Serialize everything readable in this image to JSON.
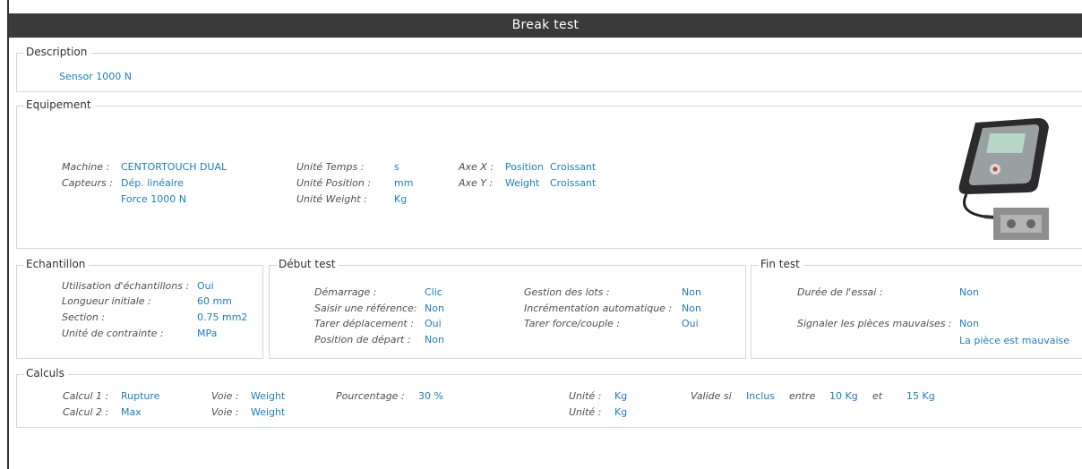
{
  "window": {
    "title": "Break test"
  },
  "description": {
    "legend": "Description",
    "value": "Sensor 1000 N"
  },
  "equipement": {
    "legend": "Equipement",
    "machine_label": "Machine :",
    "machine_value": "CENTORTOUCH DUAL",
    "capteurs_label": "Capteurs :",
    "capteur1": "Dép. linéaire",
    "capteur2": "Force 1000 N",
    "temps_label": "Unité Temps :",
    "temps_value": "s",
    "position_label": "Unité Position :",
    "position_value": "mm",
    "weight_label": "Unité Weight :",
    "weight_value": "Kg",
    "axex_label": "Axe X :",
    "axex_value": "Position",
    "axex_dir": "Croissant",
    "axey_label": "Axe Y :",
    "axey_value": "Weight",
    "axey_dir": "Croissant",
    "image_icon": "force-gauge-device-icon"
  },
  "echantillon": {
    "legend": "Echantillon",
    "utilisation_label": "Utilisation d'échantillons :",
    "utilisation_value": "Oui",
    "longueur_label": "Longueur initiale :",
    "longueur_value": "60 mm",
    "section_label": "Section :",
    "section_value": "0.75 mm2",
    "contrainte_label": "Unité de contrainte :",
    "contrainte_value": "MPa"
  },
  "debut_test": {
    "legend": "Début test",
    "demarrage_label": "Démarrage :",
    "demarrage_value": "Clic",
    "reference_label": "Saisir une référence:",
    "reference_value": "Non",
    "tarer_dep_label": "Tarer déplacement :",
    "tarer_dep_value": "Oui",
    "position_label": "Position de départ :",
    "position_value": "Non",
    "lots_label": "Gestion des lots :",
    "lots_value": "Non",
    "increment_label": "Incrémentation automatique :",
    "increment_value": "Non",
    "tarer_force_label": "Tarer force/couple :",
    "tarer_force_value": "Oui"
  },
  "fin_test": {
    "legend": "Fin test",
    "duree_label": "Durée de l'essai :",
    "duree_value": "Non",
    "signaler_label": "Signaler les pièces mauvaises :",
    "signaler_value": "Non",
    "message": "La pièce est mauvaise"
  },
  "calculs": {
    "legend": "Calculs",
    "calc1_label": "Calcul 1 :",
    "calc1_value": "Rupture",
    "calc2_label": "Calcul 2 :",
    "calc2_value": "Max",
    "voie_label": "Voie :",
    "voie1_value": "Weight",
    "voie2_value": "Weight",
    "pourcentage_label": "Pourcentage :",
    "pourcentage_value": "30 %",
    "unite_label": "Unité :",
    "unite1_value": "Kg",
    "unite2_value": "Kg",
    "valide_label": "Valide si",
    "valide_value": "Inclus",
    "entre_label": "entre",
    "min_value": "10 Kg",
    "et_label": "et",
    "max_value": "15 Kg"
  },
  "colors": {
    "titlebar": "#3a3a3a",
    "value": "#1a7fc0",
    "border": "#d6d6d6"
  }
}
